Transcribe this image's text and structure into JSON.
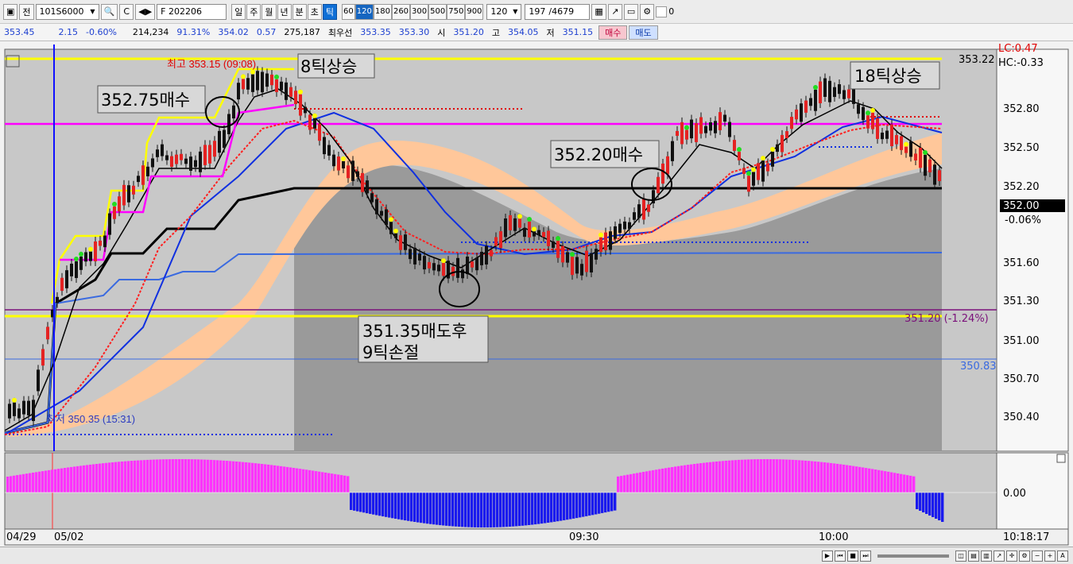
{
  "toolbar": {
    "mode_label": "전",
    "code": "101S6000",
    "product": "F 202206",
    "period_buttons": [
      "일",
      "주",
      "월",
      "년",
      "분",
      "초",
      "틱"
    ],
    "selected_period": "틱",
    "tick_buttons": [
      "60",
      "120",
      "180",
      "260",
      "300",
      "500",
      "750",
      "900"
    ],
    "selected_tick": "120",
    "tick_value": "120",
    "count": "197",
    "total": "4679",
    "checkbox_value": "0"
  },
  "quote": {
    "price": "353.45",
    "change": "2.15",
    "change_pct": "-0.60%",
    "volume": "214,234",
    "vol_ratio": "91.31%",
    "v2": "354.02",
    "v3": "0.57",
    "v4": "275,187",
    "best_label": "최우선",
    "best_bid": "353.35",
    "best_ask": "353.30",
    "open_label": "시",
    "open": "351.20",
    "high_label": "고",
    "high": "354.05",
    "low_label": "저",
    "low": "351.15",
    "buy_label": "매수",
    "sell_label": "매도"
  },
  "chart": {
    "y_labels": [
      "352.80",
      "352.50",
      "352.20",
      "351.60",
      "351.30",
      "351.00",
      "350.70",
      "350.40"
    ],
    "top_right_label": "353.22",
    "lc_label": "LC:0.47",
    "hc_label": "HC:-0.33",
    "last_price": "352.00",
    "last_pct": "-0.06%",
    "ref_label": "351.20 (-1.24%)",
    "blue_label": "350.83",
    "high_note": "최고 353.15 (09:08)",
    "low_note": "최저 350.35 (15:31)",
    "ann_8tick": "8틱상승",
    "ann_buy1": "352.75매수",
    "ann_buy2": "352.20매수",
    "ann_18tick": "18틱상승",
    "ann_sell_line1": "351.35매도후",
    "ann_sell_line2": "9틱손절",
    "osc_zero_label": "0.00",
    "x_labels": [
      "04/29",
      "05/02",
      "09:30",
      "10:00"
    ],
    "time_label": "10:18:17"
  },
  "colors": {
    "bg": "#c8c8c8",
    "upper_band": "#ffc79a",
    "gray_fill": "#9a9a9a",
    "ma_blue": "#1030e0",
    "ma_black": "#000000",
    "ma_magenta": "#ff00ff",
    "ma_yellow": "#ffff00",
    "bull": "#e52222",
    "bear": "#111111",
    "osc_pos": "#ff33ff",
    "osc_neg": "#1a1aee"
  }
}
